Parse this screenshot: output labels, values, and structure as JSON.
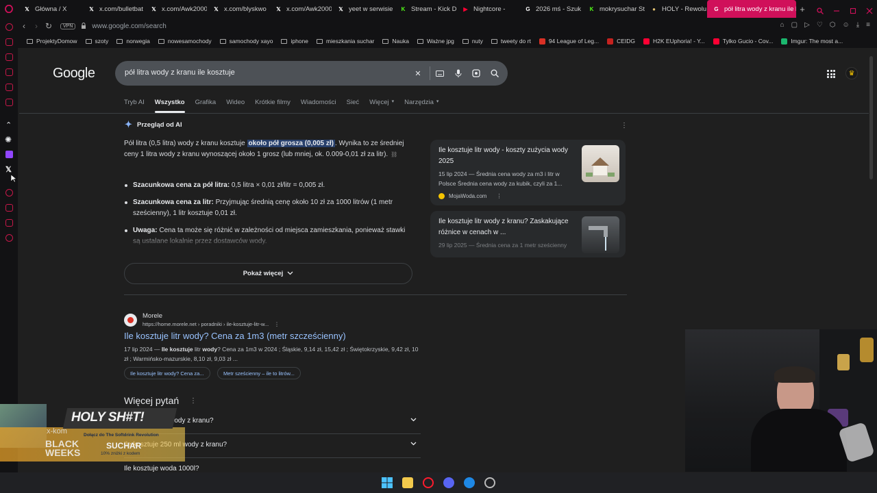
{
  "tabs": [
    {
      "label": "Główna / X",
      "icon": "x-icon",
      "color": "#ffffff"
    },
    {
      "label": "x.com/bulletbat",
      "icon": "x-icon",
      "color": "#ffffff"
    },
    {
      "label": "x.com/Awk2000",
      "icon": "x-icon",
      "color": "#ffffff"
    },
    {
      "label": "x.com/blyskwo",
      "icon": "x-icon",
      "color": "#ffffff"
    },
    {
      "label": "x.com/Awk2000",
      "icon": "x-icon",
      "color": "#ffffff"
    },
    {
      "label": "yeet w serwisie",
      "icon": "x-icon",
      "color": "#ffffff"
    },
    {
      "label": "Stream - Kick D",
      "icon": "kick-icon",
      "color": "#53fc18"
    },
    {
      "label": "Nightcore -",
      "icon": "youtube-icon",
      "color": "#ff0033"
    },
    {
      "label": "2026 mś - Szuk",
      "icon": "google-icon",
      "color": "#ffffff"
    },
    {
      "label": "mokrysuchar St",
      "icon": "kick-icon",
      "color": "#53fc18"
    },
    {
      "label": "HOLY - Rewolu",
      "icon": "site-icon",
      "color": "#e0c070"
    },
    {
      "label": "pół litra wody z kranu ile k",
      "icon": "google-icon",
      "color": "#ffffff",
      "active": true
    }
  ],
  "address": {
    "vpn": "VPN",
    "url": "www.google.com/search"
  },
  "bookmarks": [
    {
      "label": "ProjektyDomow",
      "type": "folder"
    },
    {
      "label": "szoty",
      "type": "folder"
    },
    {
      "label": "norwegia",
      "type": "folder"
    },
    {
      "label": "nowesamochody",
      "type": "folder"
    },
    {
      "label": "samochody xayo",
      "type": "folder"
    },
    {
      "label": "iphone",
      "type": "folder"
    },
    {
      "label": "mieszkania suchar",
      "type": "folder"
    },
    {
      "label": "Nauka",
      "type": "folder"
    },
    {
      "label": "Ważne jpg",
      "type": "folder"
    },
    {
      "label": "nuty",
      "type": "folder"
    },
    {
      "label": "tweety do rt",
      "type": "folder"
    },
    {
      "label": "94 League of Leg...",
      "type": "site",
      "color": "#d93025"
    },
    {
      "label": "CEIDG",
      "type": "site",
      "color": "#c5221f"
    },
    {
      "label": "H2K EUphoria! - Y...",
      "type": "site",
      "color": "#ff0033"
    },
    {
      "label": "Tylko Gucio - Cov...",
      "type": "site",
      "color": "#ff0033"
    },
    {
      "label": "Imgur: The most a...",
      "type": "site",
      "color": "#1bb76e"
    }
  ],
  "google": {
    "logo": "Google",
    "query": "pół litra wody z kranu ile kosztuje",
    "filters": [
      "Tryb AI",
      "Wszystko",
      "Grafika",
      "Wideo",
      "Krótkie filmy",
      "Wiadomości",
      "Sieć",
      "Więcej",
      "Narzędzia"
    ],
    "active_filter": "Wszystko"
  },
  "ai_overview": {
    "header": "Przegląd od AI",
    "para_before": "Pół litra (0,5 litra) wody z kranu kosztuje ",
    "para_highlight": "około pół grosza (0,005 zł)",
    "para_after": ". Wynika to ze średniej ceny 1 litra wody z kranu wynoszącej około 1 grosz (lub mniej, ok. 0.009-0,01 zł za litr).",
    "bullets": [
      {
        "bold": "Szacunkowa cena za pół litra:",
        "text": " 0,5 litra × 0,01 zł/litr = 0,005 zł."
      },
      {
        "bold": "Szacunkowa cena za litr:",
        "text": " Przyjmując średnią cenę około 10 zł za 1000 litrów (1 metr sześcienny), 1 litr kosztuje 0,01 zł."
      },
      {
        "bold": "Uwaga:",
        "text": " Cena ta może się różnić w zależności od miejsca zamieszkania, ponieważ stawki są ustalane lokalnie przez dostawców wody."
      }
    ],
    "show_more": "Pokaż więcej",
    "sources": [
      {
        "title": "Ile kosztuje litr wody - koszty zużycia wody 2025",
        "snippet": "15 lip 2024 — Średnia cena wody za m3 i litr w Polsce Średnia cena wody za kubik, czyli za 1...",
        "site": "MojaWoda.com"
      },
      {
        "title": "Ile kosztuje litr wody z kranu? Zaskakujące różnice w cenach w ...",
        "snippet": "29 lip 2025 — Średnia cena za 1 metr sześcienny"
      }
    ]
  },
  "result": {
    "site": "Morele",
    "url": "https://home.morele.net › poradniki › ile-kosztuje-litr-w...",
    "title": "Ile kosztuje litr wody? Cena za 1m3 (metr szcześcienny)",
    "snippet_date": "17 lip 2024 — ",
    "snippet_bold": "Ile kosztuje",
    "snippet_mid": " litr ",
    "snippet_bold2": "wody",
    "snippet_rest": "? Cena za 1m3 w 2024 ; Śląskie, 9,14 zł, 15,42 zł ; Świętokrzyskie, 9,42 zł, 10 zł ; Warmińsko-mazurskie, 8,10 zł, 9,03 zł ...",
    "chips": [
      "Ile kosztuje litr wody? Cena za...",
      "Metr sześcienny – ile to litrów..."
    ]
  },
  "paa": {
    "title": "Więcej pytań",
    "questions": [
      "Ile kosztuje litr wody z kranu?",
      "Ile kosztuje 250 ml wody z kranu?",
      "Ile kosztuje woda 1000l?"
    ]
  },
  "overlay": {
    "title": "HOLY SH#T!",
    "sub": "Dołącz do The Softdrink Revolution",
    "promo": "BLACK WEEKS",
    "brand": "SUCHAR",
    "discount": "10% zniżki z kodem",
    "store": "x-kom"
  },
  "colors": {
    "accent": "#d0105a",
    "link": "#99c3ff",
    "highlight": "#28406c"
  }
}
